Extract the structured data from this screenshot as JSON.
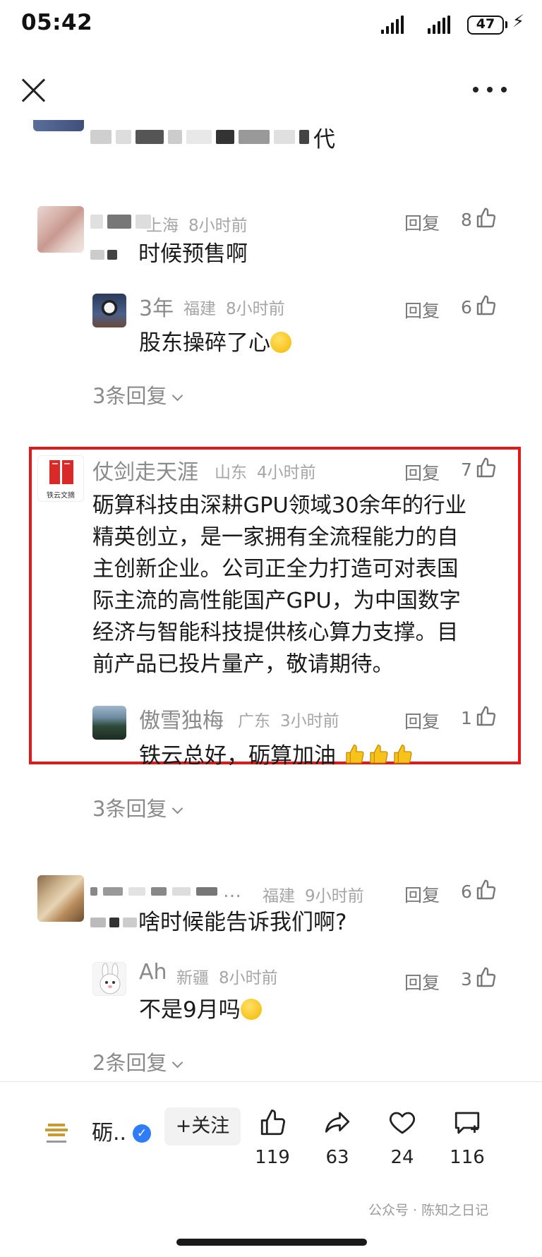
{
  "status_bar": {
    "time": "05:42",
    "battery": "47"
  },
  "comments": [
    {
      "partial_text": "代"
    },
    {
      "location": "上海",
      "time": "8小时前",
      "reply_label": "回复",
      "likes": "8",
      "text": "时候预售啊",
      "reply": {
        "name": "3年",
        "location": "福建",
        "time": "8小时前",
        "reply_label": "回复",
        "likes": "6",
        "text": "股东操碎了心"
      },
      "more_replies": "3条回复"
    },
    {
      "name": "仗剑走天涯",
      "location": "山东",
      "time": "4小时前",
      "reply_label": "回复",
      "likes": "7",
      "avatar_text": "铁云文摘",
      "lines": [
        "砺算科技由深耕GPU领域30余年的行业",
        "精英创立，是一家拥有全流程能力的自",
        "主创新企业。公司正全力打造可对表国",
        "际主流的高性能国产GPU，为中国数字",
        "经济与智能科技提供核心算力支撑。目",
        "前产品已投片量产，敬请期待。"
      ],
      "reply": {
        "name": "傲雪独梅",
        "location": "广东",
        "time": "3小时前",
        "reply_label": "回复",
        "likes": "1",
        "text": "铁云总好，砺算加油"
      },
      "more_replies": "3条回复"
    },
    {
      "location": "福建",
      "time": "9小时前",
      "reply_label": "回复",
      "likes": "6",
      "ellipsis": "…",
      "text": "啥时候能告诉我们啊?",
      "reply": {
        "name": "Ah",
        "location": "新疆",
        "time": "8小时前",
        "reply_label": "回复",
        "likes": "3",
        "text": "不是9月吗"
      },
      "more_replies": "2条回复"
    }
  ],
  "bottom_bar": {
    "account_name": "砺..",
    "follow_label": "+关注",
    "like_count": "119",
    "share_count": "63",
    "favorite_count": "24",
    "comment_count": "116"
  },
  "watermark": "公众号 · 陈知之日记",
  "colors": {
    "highlight_border": "#e41818",
    "verified": "#2f7cf6"
  }
}
